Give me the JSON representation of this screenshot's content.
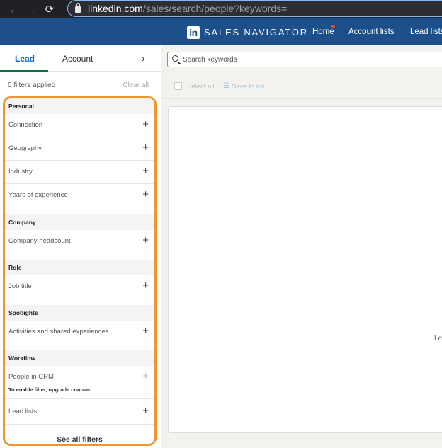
{
  "browser": {
    "back_glyph": "←",
    "forward_glyph": "→",
    "reload_glyph": "⟳",
    "url_domain": "linkedin.com",
    "url_path": "/sales/search/people?keywords="
  },
  "header": {
    "logo_text": "in",
    "brand": "SALES NAVIGATOR",
    "nav": [
      "Home",
      "Account lists",
      "Lead lists"
    ],
    "accent_color": "#1d4f8a",
    "notification_color": "#e5463f"
  },
  "sidebar": {
    "tabs": [
      {
        "label": "Lead",
        "active": true
      },
      {
        "label": "Account",
        "active": false
      }
    ],
    "tab_chevron": "›",
    "filters_applied": "0 filters applied",
    "clear_all": "Clear all",
    "sections": [
      {
        "label": "Personal",
        "filters": [
          {
            "label": "Connection"
          },
          {
            "label": "Geography"
          },
          {
            "label": "Industry"
          },
          {
            "label": "Years of experience"
          }
        ]
      },
      {
        "label": "Company",
        "filters": [
          {
            "label": "Company headcount"
          }
        ]
      },
      {
        "label": "Role",
        "filters": [
          {
            "label": "Job title"
          }
        ]
      },
      {
        "label": "Spotlights",
        "filters": [
          {
            "label": "Activities and shared experiences"
          }
        ]
      },
      {
        "label": "Workflow",
        "filters": [
          {
            "label": "People in CRM",
            "note": "To enable filter, upgrade contract",
            "disabled": true
          },
          {
            "label": "Lead lists"
          }
        ]
      }
    ],
    "plus_glyph": "+",
    "see_all": "See all filters",
    "frame_color": "#eb9732"
  },
  "main": {
    "search_placeholder": "Search keywords",
    "select_all": "Select all",
    "list_glyph": "☰",
    "save_to_list": "Save to list",
    "results_partial_text": "Le"
  }
}
